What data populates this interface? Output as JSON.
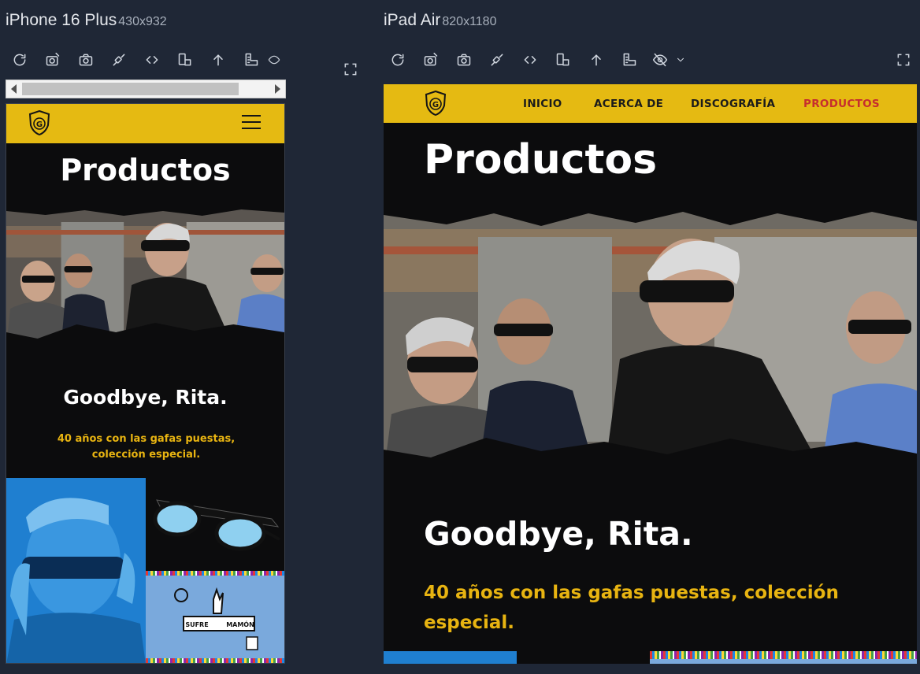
{
  "devices": [
    {
      "name": "iPhone 16 Plus",
      "dims": "430x932"
    },
    {
      "name": "iPad Air",
      "dims": "820x1180"
    }
  ],
  "site": {
    "nav": [
      "INICIO",
      "ACERCA DE",
      "DISCOGRAFÍA",
      "PRODUCTOS"
    ],
    "active_nav": "PRODUCTOS",
    "page_title": "Productos",
    "headline": "Goodbye, Rita.",
    "subline": "40 años con las gafas puestas, colección especial.",
    "logo_letter": "G",
    "tile_text_left": "SUFRE",
    "tile_text_right": "MAMÓN"
  },
  "colors": {
    "nav_bg": "#e5ba12",
    "page_bg": "#0c0c0d",
    "accent_yellow": "#e8b411",
    "active_link": "#c62e2e",
    "tool_bg": "#1f2736"
  },
  "toolbar_icons": [
    "refresh-icon",
    "capture-area-icon",
    "screenshot-icon",
    "network-throttle-icon",
    "code-icon",
    "rotate-icon",
    "scroll-top-icon",
    "ruler-icon",
    "hide-icon"
  ]
}
